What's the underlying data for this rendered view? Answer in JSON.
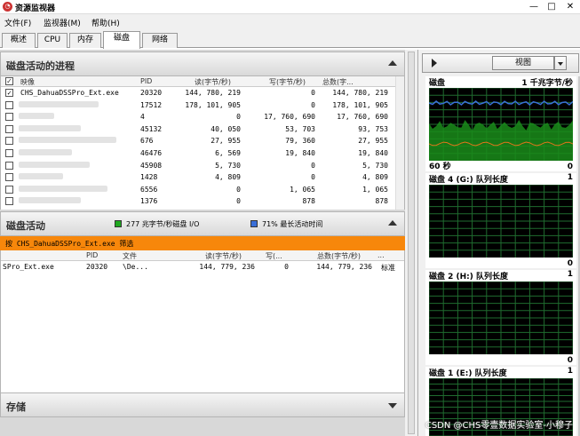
{
  "window": {
    "title": "资源监视器",
    "minimize": "—",
    "maximize": "□",
    "close": "✕"
  },
  "menu": [
    "文件(F)",
    "监视器(M)",
    "帮助(H)"
  ],
  "tabs": [
    "概述",
    "CPU",
    "内存",
    "磁盘",
    "网络"
  ],
  "active_tab": "磁盘",
  "processes_section": {
    "title": "磁盘活动的进程",
    "columns": [
      "映像",
      "PID",
      "读(字节/秒)",
      "写(字节/秒)",
      "总数(字..."
    ],
    "rows": [
      {
        "checked": true,
        "image": "CHS_DahuaDSSPro_Ext.exe",
        "pid": "20320",
        "read": "144, 780, 219",
        "write": "0",
        "total": "144, 780, 219"
      },
      {
        "checked": false,
        "image": "",
        "pid": "17512",
        "read": "178, 101, 905",
        "write": "0",
        "total": "178, 101, 905"
      },
      {
        "checked": false,
        "image": "",
        "pid": "4",
        "read": "0",
        "write": "17, 760, 690",
        "total": "17, 760, 690"
      },
      {
        "checked": false,
        "image": "",
        "pid": "45132",
        "read": "40, 050",
        "write": "53, 703",
        "total": "93, 753"
      },
      {
        "checked": false,
        "image": "",
        "pid": "676",
        "read": "27, 955",
        "write": "79, 360",
        "total": "27, 955"
      },
      {
        "checked": false,
        "image": "",
        "pid": "46476",
        "read": "6, 569",
        "write": "19, 840",
        "total": "19, 840"
      },
      {
        "checked": false,
        "image": "",
        "pid": "45908",
        "read": "5, 730",
        "write": "0",
        "total": "5, 730"
      },
      {
        "checked": false,
        "image": "",
        "pid": "1428",
        "read": "4, 809",
        "write": "0",
        "total": "4, 809"
      },
      {
        "checked": false,
        "image": "",
        "pid": "6556",
        "read": "0",
        "write": "1, 065",
        "total": "1, 065"
      },
      {
        "checked": false,
        "image": "",
        "pid": "1376",
        "read": "0",
        "write": "878",
        "total": "878"
      }
    ]
  },
  "disk_activity": {
    "title": "磁盘活动",
    "io_label": "277 兆字节/秒磁盘 I/O",
    "io_color": "#1fa81f",
    "active_label": "71% 最长活动时间",
    "active_color": "#3a6fd8",
    "filter_text": "按 CHS_DahuaDSSPro_Ext.exe 筛选",
    "filter_color": "#f7870b",
    "columns": [
      "",
      "PID",
      "文件",
      "读(字节/秒)",
      "写(...",
      "总数(字节/秒)",
      "..."
    ],
    "rows": [
      {
        "image": "SPro_Ext.exe",
        "pid": "20320",
        "file": "\\De...",
        "read": "144, 779, 236",
        "write": "0",
        "total": "144, 779, 236",
        "extra": "标准"
      }
    ]
  },
  "storage_section": {
    "title": "存储"
  },
  "right_panel": {
    "view_label": "视图",
    "graphs": [
      {
        "title": "磁盘",
        "value": "1 千兆字节/秒",
        "footer_left": "60 秒",
        "footer_right": "0"
      },
      {
        "title": "磁盘 4 (G:) 队列长度",
        "value": "1",
        "footer_right": "0"
      },
      {
        "title": "磁盘 2 (H:) 队列长度",
        "value": "1",
        "footer_right": "0"
      },
      {
        "title": "磁盘 1 (E:) 队列长度",
        "value": "1"
      }
    ]
  },
  "watermark": "CSDN @CHS零壹数据实验室-小穆子"
}
